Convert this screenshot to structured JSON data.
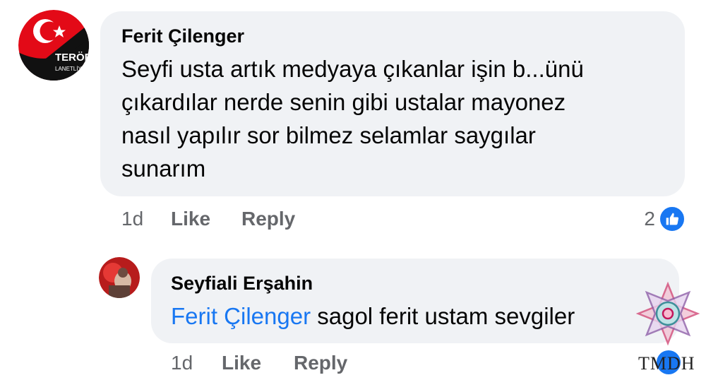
{
  "comment": {
    "author": "Ferit Çilenger",
    "text_lines": [
      "Seyfi usta artık medyaya çıkanlar işin b...ünü",
      "çıkardılar nerde senin gibi ustalar mayonez",
      "nasıl yapılır sor bilmez selamlar saygılar",
      "sunarım"
    ],
    "time": "1d",
    "like_label": "Like",
    "reply_label": "Reply",
    "reaction_count": "2",
    "avatar": {
      "icon": "turkish-flag-avatar",
      "text_top": "TERÖR",
      "text_bottom": "LANETLİYO"
    }
  },
  "reply": {
    "author": "Seyfiali Erşahin",
    "mention": "Ferit Çilenger",
    "text": "sagol  ferit ustam sevgiler",
    "time": "1d",
    "like_label": "Like",
    "reply_label": "Reply"
  },
  "watermark": {
    "text": "TMDH"
  },
  "colors": {
    "bubble": "#f0f2f5",
    "link": "#1877f2",
    "meta": "#65676b",
    "text": "#050505"
  }
}
